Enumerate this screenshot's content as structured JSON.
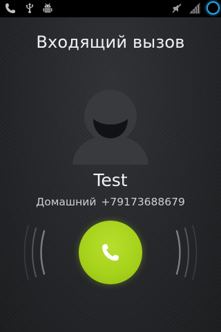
{
  "status_bar": {
    "left_icons": [
      "phone-icon",
      "usb-icon",
      "android-debug-icon"
    ],
    "right_icons": [
      "vibrate-muted-icon",
      "signal-icon",
      "loading-spinner-icon"
    ]
  },
  "call": {
    "title": "Входящий вызов",
    "caller_name": "Test",
    "number_label": "Домашний",
    "number": "+79173688679"
  },
  "colors": {
    "accent": "#a7d21c",
    "status_accent": "#2ba3ea",
    "background": "#242528"
  }
}
